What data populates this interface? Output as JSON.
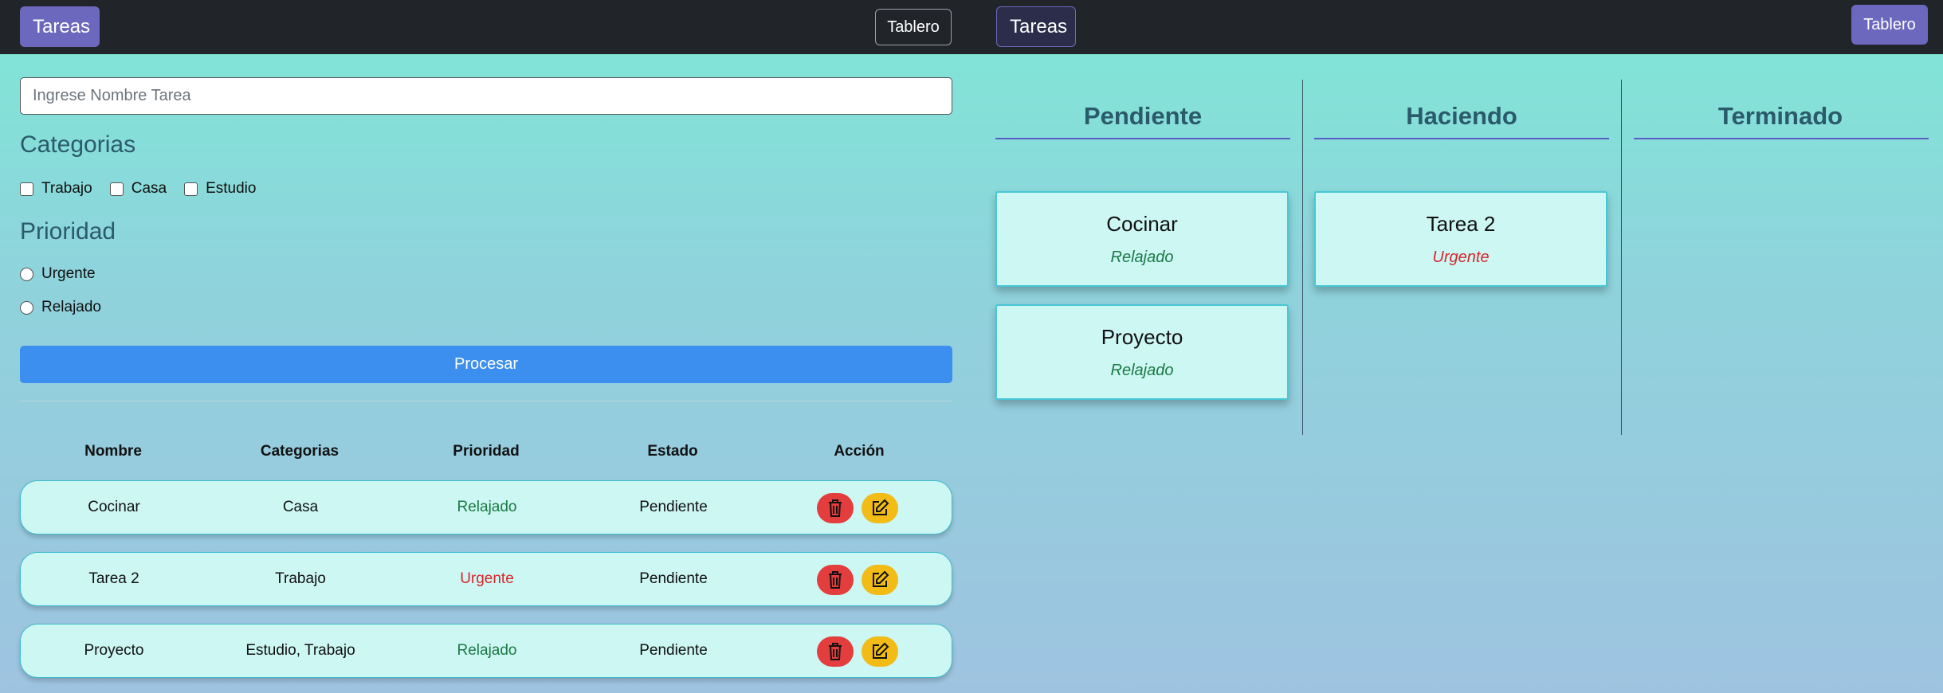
{
  "left_nav": {
    "brand": "Tareas",
    "board_button": "Tablero"
  },
  "right_nav": {
    "brand": "Tareas",
    "board_button": "Tablero"
  },
  "form": {
    "task_placeholder": "Ingrese Nombre Tarea",
    "categories_title": "Categorias",
    "categories": [
      "Trabajo",
      "Casa",
      "Estudio"
    ],
    "priority_title": "Prioridad",
    "priorities": [
      "Urgente",
      "Relajado"
    ],
    "submit_label": "Procesar"
  },
  "table": {
    "headers": [
      "Nombre",
      "Categorias",
      "Prioridad",
      "Estado",
      "Acción"
    ],
    "rows": [
      {
        "name": "Cocinar",
        "categories": "Casa",
        "priority": "Relajado",
        "status": "Pendiente"
      },
      {
        "name": "Tarea 2",
        "categories": "Trabajo",
        "priority": "Urgente",
        "status": "Pendiente"
      },
      {
        "name": "Proyecto",
        "categories": "Estudio, Trabajo",
        "priority": "Relajado",
        "status": "Pendiente"
      }
    ]
  },
  "board": {
    "columns": [
      {
        "title": "Pendiente",
        "cards": [
          {
            "title": "Cocinar",
            "priority": "Relajado"
          },
          {
            "title": "Proyecto",
            "priority": "Relajado"
          }
        ]
      },
      {
        "title": "Haciendo",
        "cards": [
          {
            "title": "Tarea 2",
            "priority": "Urgente"
          }
        ]
      },
      {
        "title": "Terminado",
        "cards": []
      }
    ]
  },
  "colors": {
    "nav_bg": "#212529",
    "brand": "#6b68bd",
    "primary_button": "#3d8fef",
    "relajado": "#1a7a44",
    "urgente": "#d9262c",
    "delete_button": "#e33d3d",
    "edit_button": "#f2bb16"
  },
  "icons": {
    "delete": "trash-icon",
    "edit": "edit-icon"
  }
}
